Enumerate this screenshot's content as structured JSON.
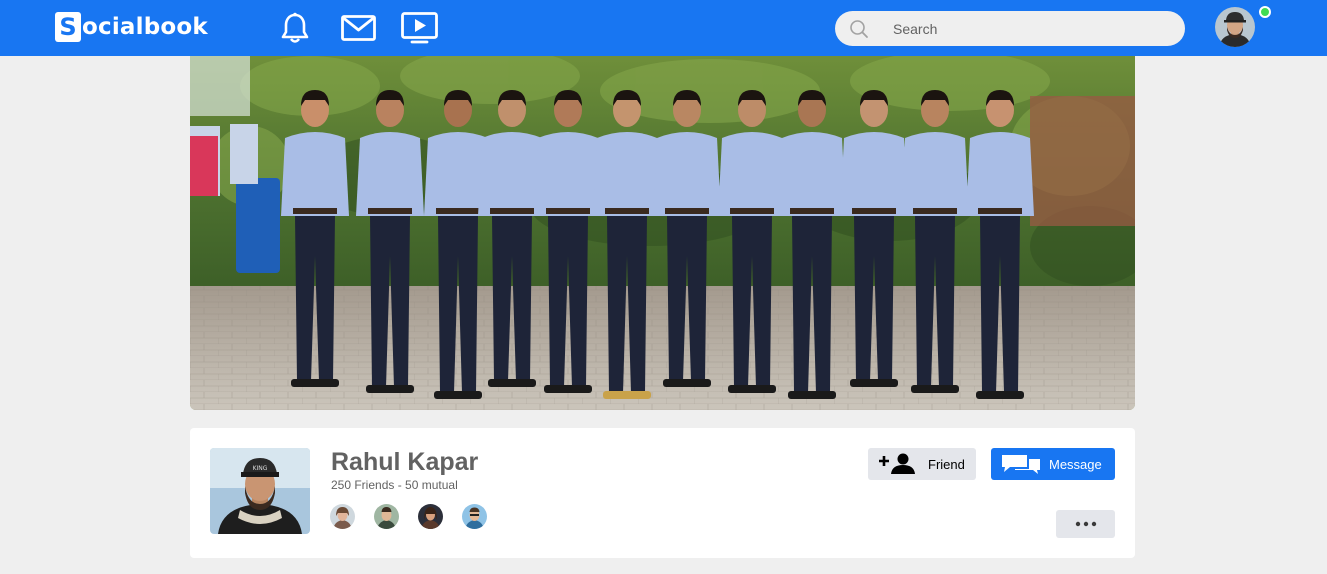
{
  "navbar": {
    "logo_letter": "S",
    "logo_rest": "ocialbook",
    "icons": [
      "bell-icon",
      "mail-icon",
      "video-play-icon"
    ],
    "search_placeholder": "Search",
    "online_status_color": "#41db51"
  },
  "cover": {
    "type": "group-photo"
  },
  "profile": {
    "name": "Rahul Kapar",
    "friends_summary": "250 Friends - 50 mutual",
    "mutual_friend_count_shown": 4
  },
  "actions": {
    "friend_label": "Friend",
    "message_label": "Message",
    "more_label": "•••"
  },
  "colors": {
    "brand": "#1876f2",
    "page_bg": "#efefef",
    "button_gray": "#e4e6eb",
    "text_gray": "#626262"
  }
}
